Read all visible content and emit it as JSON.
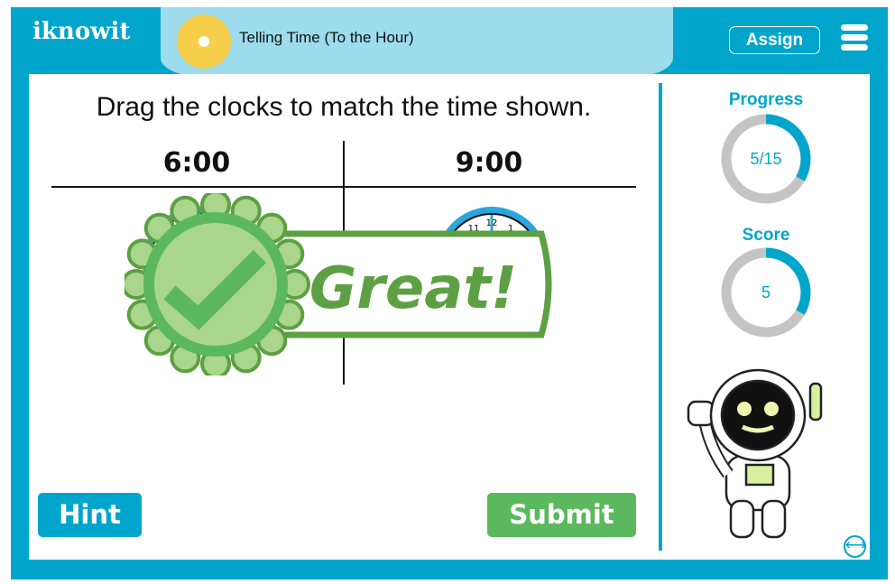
{
  "header": {
    "logo": "iknowit",
    "title": "Telling Time (To the Hour)",
    "assign_label": "Assign",
    "menu_icon": "hamburger-icon"
  },
  "activity": {
    "instruction": "Drag the clocks to match the time shown.",
    "columns": [
      "6:00",
      "9:00"
    ],
    "feedback": "Great!",
    "hint_label": "Hint",
    "submit_label": "Submit"
  },
  "sidebar": {
    "progress_label": "Progress",
    "progress_text": "5/15",
    "progress_fraction": 0.333,
    "score_label": "Score",
    "score_text": "5",
    "score_fraction": 0.333
  },
  "colors": {
    "brand": "#00a5cc",
    "accent_green": "#5cb85c",
    "ring_gray": "#c4c4c4"
  }
}
